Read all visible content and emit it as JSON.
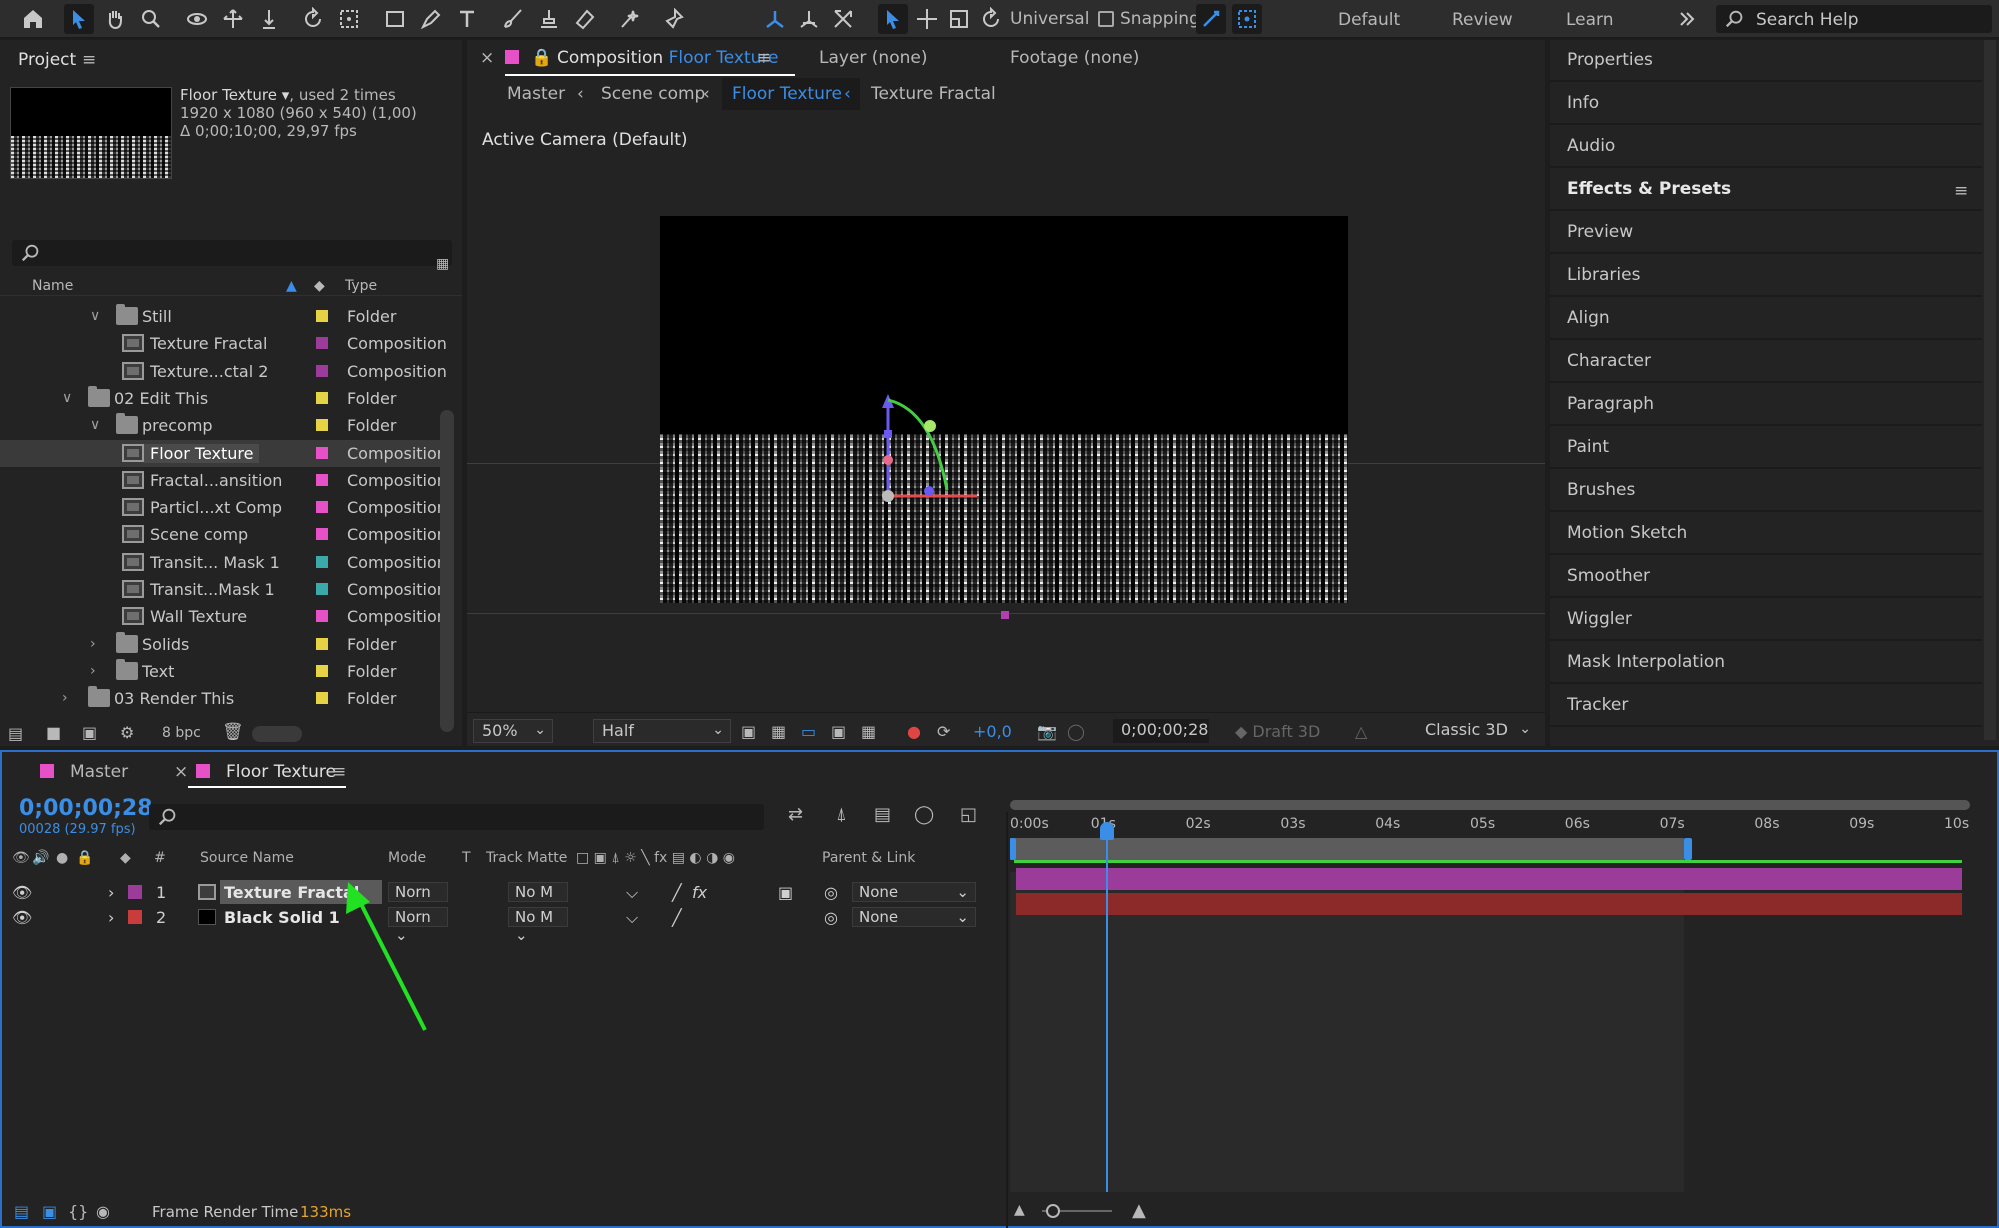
{
  "toolbar": {
    "universal_label": "Universal",
    "snapping_label": "Snapping",
    "workspaces": [
      "Default",
      "Review",
      "Learn"
    ],
    "search_placeholder": "Search Help"
  },
  "project": {
    "title": "Project",
    "item_name": "Floor Texture ▾",
    "item_usage": ", used 2 times",
    "item_size": "1920 x 1080  (960 x 540) (1,00)",
    "item_duration": "Δ 0;00;10;00, 29,97 fps",
    "columns": {
      "name": "Name",
      "type": "Type"
    },
    "rows": [
      {
        "name": "Still",
        "type": "Folder",
        "kind": "folder",
        "label_color": "#e6d245",
        "indent": 1,
        "expanded": true
      },
      {
        "name": "Texture Fractal",
        "type": "Composition",
        "kind": "comp",
        "label_color": "#9b3c9b",
        "indent": 2
      },
      {
        "name": "Texture...ctal 2",
        "type": "Composition",
        "kind": "comp",
        "label_color": "#9b3c9b",
        "indent": 2
      },
      {
        "name": "02 Edit This",
        "type": "Folder",
        "kind": "folder",
        "label_color": "#e6d245",
        "indent": 0,
        "expanded": true
      },
      {
        "name": "precomp",
        "type": "Folder",
        "kind": "folder",
        "label_color": "#e6d245",
        "indent": 1,
        "expanded": true
      },
      {
        "name": "Floor Texture",
        "type": "Composition",
        "kind": "comp",
        "label_color": "#e651c8",
        "indent": 2,
        "selected": true
      },
      {
        "name": "Fractal...ansition",
        "type": "Composition",
        "kind": "comp",
        "label_color": "#e651c8",
        "indent": 2
      },
      {
        "name": "Particl...xt Comp",
        "type": "Composition",
        "kind": "comp",
        "label_color": "#e651c8",
        "indent": 2
      },
      {
        "name": "Scene comp",
        "type": "Composition",
        "kind": "comp",
        "label_color": "#e651c8",
        "indent": 2
      },
      {
        "name": "Transit... Mask 1",
        "type": "Composition",
        "kind": "comp",
        "label_color": "#3aa9a9",
        "indent": 2
      },
      {
        "name": "Transit...Mask 1",
        "type": "Composition",
        "kind": "comp",
        "label_color": "#3aa9a9",
        "indent": 2
      },
      {
        "name": "Wall Texture",
        "type": "Composition",
        "kind": "comp",
        "label_color": "#e651c8",
        "indent": 2
      },
      {
        "name": "Solids",
        "type": "Folder",
        "kind": "folder",
        "label_color": "#e6d245",
        "indent": 1,
        "expanded": false
      },
      {
        "name": "Text",
        "type": "Folder",
        "kind": "folder",
        "label_color": "#e6d245",
        "indent": 1,
        "expanded": false
      },
      {
        "name": "03 Render This",
        "type": "Folder",
        "kind": "folder",
        "label_color": "#e6d245",
        "indent": 0,
        "expanded": false
      }
    ],
    "bpc": "8 bpc"
  },
  "composition": {
    "tab_prefix": "Composition",
    "tab_name": "Floor Texture",
    "layer_tab": "Layer (none)",
    "footage_tab": "Footage (none)",
    "breadcrumbs": [
      "Master",
      "Scene comp",
      "Floor Texture",
      "Texture Fractal"
    ],
    "view_label": "Active Camera (Default)",
    "zoom": "50%",
    "resolution": "Half",
    "exposure": "+0,0",
    "timecode": "0;00;00;28",
    "draft3d": "Draft 3D",
    "renderer": "Classic 3D"
  },
  "right_panel": {
    "items": [
      "Properties",
      "Info",
      "Audio",
      "Effects & Presets",
      "Preview",
      "Libraries",
      "Align",
      "Character",
      "Paragraph",
      "Paint",
      "Brushes",
      "Motion Sketch",
      "Smoother",
      "Wiggler",
      "Mask Interpolation",
      "Tracker"
    ],
    "bold_item": "Effects & Presets"
  },
  "timeline": {
    "tabs": [
      "Master",
      "Floor Texture"
    ],
    "timecode": "0;00;00;28",
    "frames_sub": "00028 (29.97 fps)",
    "columns": {
      "hash": "#",
      "source_name": "Source Name",
      "mode": "Mode",
      "t": "T",
      "track_matte": "Track Matte",
      "parent": "Parent & Link"
    },
    "layers": [
      {
        "num": "1",
        "name": "Texture Fractal",
        "mode": "Norn",
        "matte": "No M",
        "parent": "None",
        "label_color": "#9b3c9b"
      },
      {
        "num": "2",
        "name": "Black Solid 1",
        "mode": "Norn",
        "matte": "No M",
        "parent": "None",
        "label_color": "#c83c3c"
      }
    ],
    "ticks": [
      "0:00s",
      "01s",
      "02s",
      "03s",
      "04s",
      "05s",
      "06s",
      "07s",
      "08s",
      "09s",
      "10s"
    ],
    "frame_render_label": "Frame Render Time",
    "frame_render_value": "133ms"
  },
  "colors": {
    "accent": "#3a8ee6",
    "highlight_text": "#3a8ee6",
    "arrow": "#22e022"
  }
}
